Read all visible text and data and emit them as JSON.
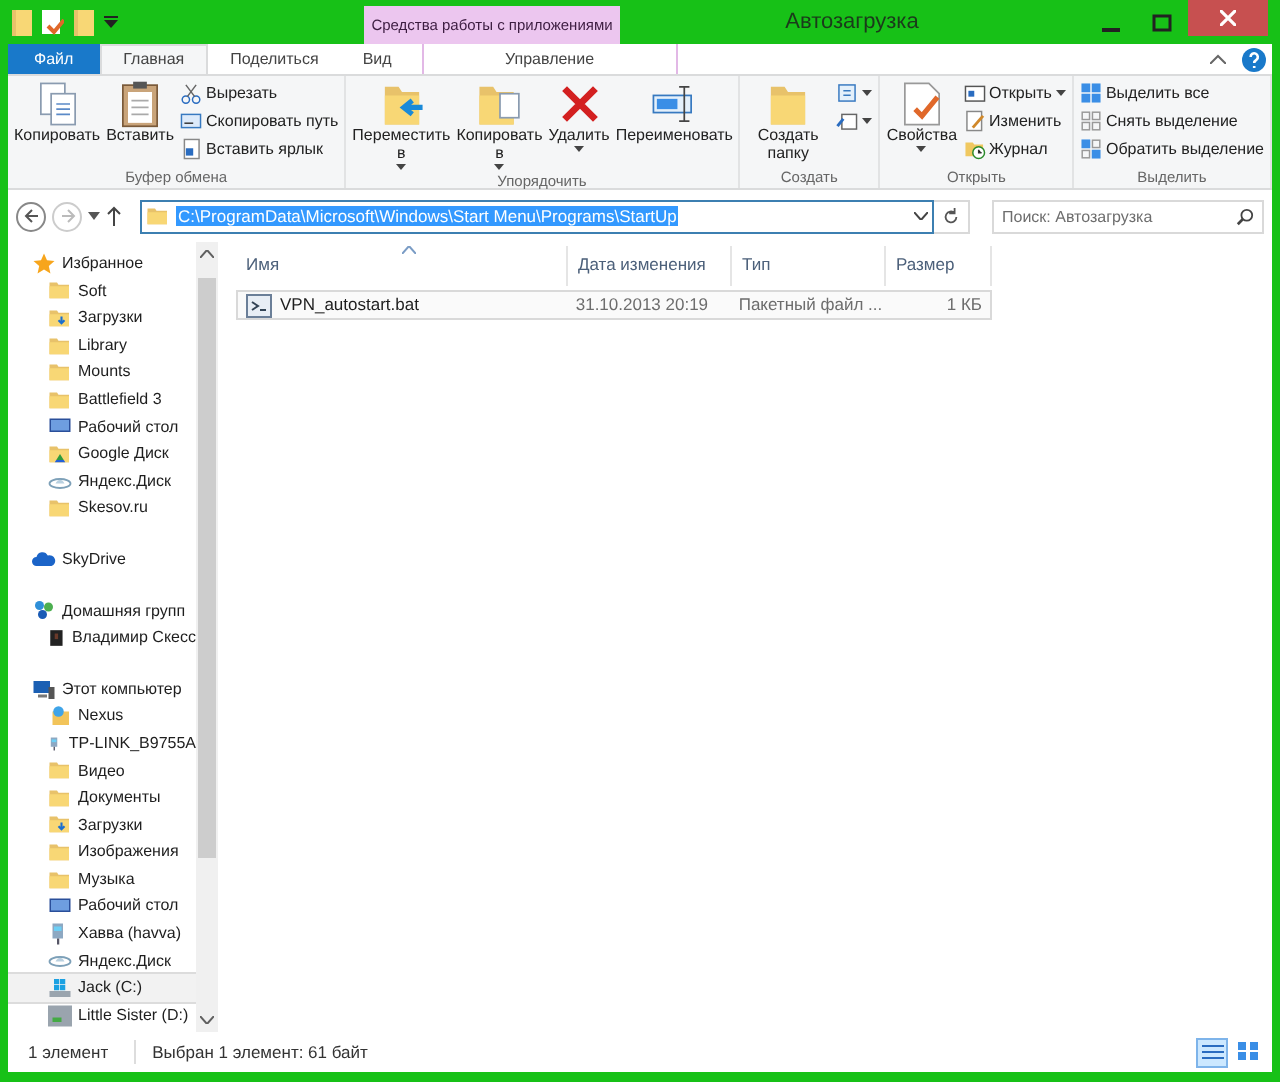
{
  "window": {
    "title": "Автозагрузка"
  },
  "context_tab": {
    "header": "Средства работы с приложениями",
    "label": "Управление",
    "selected": false
  },
  "tabs": [
    {
      "label": "Файл",
      "kind": "file",
      "selected": false
    },
    {
      "label": "Главная",
      "kind": "tab",
      "selected": true
    },
    {
      "label": "Поделиться",
      "kind": "tab",
      "selected": false
    },
    {
      "label": "Вид",
      "kind": "tab",
      "selected": false
    }
  ],
  "ribbon": [
    {
      "label": "Буфер обмена",
      "items": [
        {
          "label": "Копировать",
          "kind": "large",
          "dropdown": false
        },
        {
          "label": "Вставить",
          "kind": "large",
          "dropdown": false
        },
        {
          "label": "Вырезать",
          "kind": "small",
          "dropdown": false
        },
        {
          "label": "Скопировать путь",
          "kind": "small",
          "dropdown": false
        },
        {
          "label": "Вставить ярлык",
          "kind": "small",
          "dropdown": false
        }
      ]
    },
    {
      "label": "Упорядочить",
      "items": [
        {
          "label": "Переместить в",
          "kind": "large",
          "dropdown": true
        },
        {
          "label": "Копировать в",
          "kind": "large",
          "dropdown": true
        },
        {
          "label": "Удалить",
          "kind": "large",
          "dropdown": true
        },
        {
          "label": "Переименовать",
          "kind": "large",
          "dropdown": false
        }
      ]
    },
    {
      "label": "Создать",
      "items": [
        {
          "label": "Создать папку",
          "kind": "large",
          "dropdown": false
        },
        {
          "kind": "small",
          "dropdown": true
        },
        {
          "kind": "small",
          "dropdown": true
        }
      ]
    },
    {
      "label": "Открыть",
      "items": [
        {
          "label": "Свойства",
          "kind": "large",
          "dropdown": true
        },
        {
          "label": "Открыть",
          "kind": "small",
          "dropdown": true
        },
        {
          "label": "Изменить",
          "kind": "small",
          "dropdown": false
        },
        {
          "label": "Журнал",
          "kind": "small",
          "dropdown": false
        }
      ]
    },
    {
      "label": "Выделить",
      "items": [
        {
          "label": "Выделить все",
          "kind": "small",
          "dropdown": false
        },
        {
          "label": "Снять выделение",
          "kind": "small",
          "dropdown": false
        },
        {
          "label": "Обратить выделение",
          "kind": "small",
          "dropdown": false
        }
      ]
    }
  ],
  "address": {
    "path": "C:\\ProgramData\\Microsoft\\Windows\\Start Menu\\Programs\\StartUp",
    "selected": true
  },
  "search": {
    "placeholder": "Поиск: Автозагрузка"
  },
  "nav": [
    {
      "label": "Избранное",
      "kind": "star",
      "selected": false,
      "children": [
        {
          "label": "Soft",
          "kind": "folder",
          "selected": false
        },
        {
          "label": "Загрузки",
          "kind": "downloads",
          "selected": false
        },
        {
          "label": "Library",
          "kind": "folder",
          "selected": false
        },
        {
          "label": "Mounts",
          "kind": "folder",
          "selected": false
        },
        {
          "label": "Battlefield 3",
          "kind": "folder",
          "selected": false
        },
        {
          "label": "Рабочий стол",
          "kind": "desktop",
          "selected": false
        },
        {
          "label": "Google Диск",
          "kind": "gdrive",
          "selected": false
        },
        {
          "label": "Яндекс.Диск",
          "kind": "yadisk",
          "selected": false
        },
        {
          "label": "Skesov.ru",
          "kind": "folder",
          "selected": false
        }
      ]
    },
    {
      "label": "SkyDrive",
      "kind": "skydrive",
      "selected": false
    },
    {
      "label": "Домашняя групп",
      "kind": "homegroup",
      "selected": false,
      "children": [
        {
          "label": "Владимир Скесс",
          "kind": "user",
          "selected": false
        }
      ]
    },
    {
      "label": "Этот компьютер",
      "kind": "computer",
      "selected": false,
      "children": [
        {
          "label": "Nexus",
          "kind": "device",
          "selected": false
        },
        {
          "label": "TP-LINK_B9755A",
          "kind": "network",
          "selected": false
        },
        {
          "label": "Видео",
          "kind": "folder",
          "selected": false
        },
        {
          "label": "Документы",
          "kind": "folder",
          "selected": false
        },
        {
          "label": "Загрузки",
          "kind": "downloads",
          "selected": false
        },
        {
          "label": "Изображения",
          "kind": "folder",
          "selected": false
        },
        {
          "label": "Музыка",
          "kind": "folder",
          "selected": false
        },
        {
          "label": "Рабочий стол",
          "kind": "desktop",
          "selected": false
        },
        {
          "label": "Хавва (havva)",
          "kind": "network",
          "selected": false
        },
        {
          "label": "Яндекс.Диск",
          "kind": "yadisk",
          "selected": false
        },
        {
          "label": "Jack (C:)",
          "kind": "drivec",
          "selected": true
        },
        {
          "label": "Little Sister (D:)",
          "kind": "drive",
          "selected": false
        }
      ]
    }
  ],
  "table": {
    "columns": [
      {
        "label": "Имя",
        "sorted": true
      },
      {
        "label": "Дата изменения",
        "sorted": false
      },
      {
        "label": "Тип",
        "sorted": false
      },
      {
        "label": "Размер",
        "sorted": false
      }
    ],
    "rows": [
      {
        "name": "VPN_autostart.bat",
        "date": "31.10.2013 20:19",
        "type": "Пакетный файл ...",
        "size": "1 КБ",
        "focused": true
      }
    ]
  },
  "status_bar": {
    "count": "1 элемент",
    "selection": "Выбран 1 элемент: 61 байт"
  },
  "views": [
    {
      "kind": "details",
      "selected": true
    },
    {
      "kind": "tiles",
      "selected": false
    }
  ]
}
